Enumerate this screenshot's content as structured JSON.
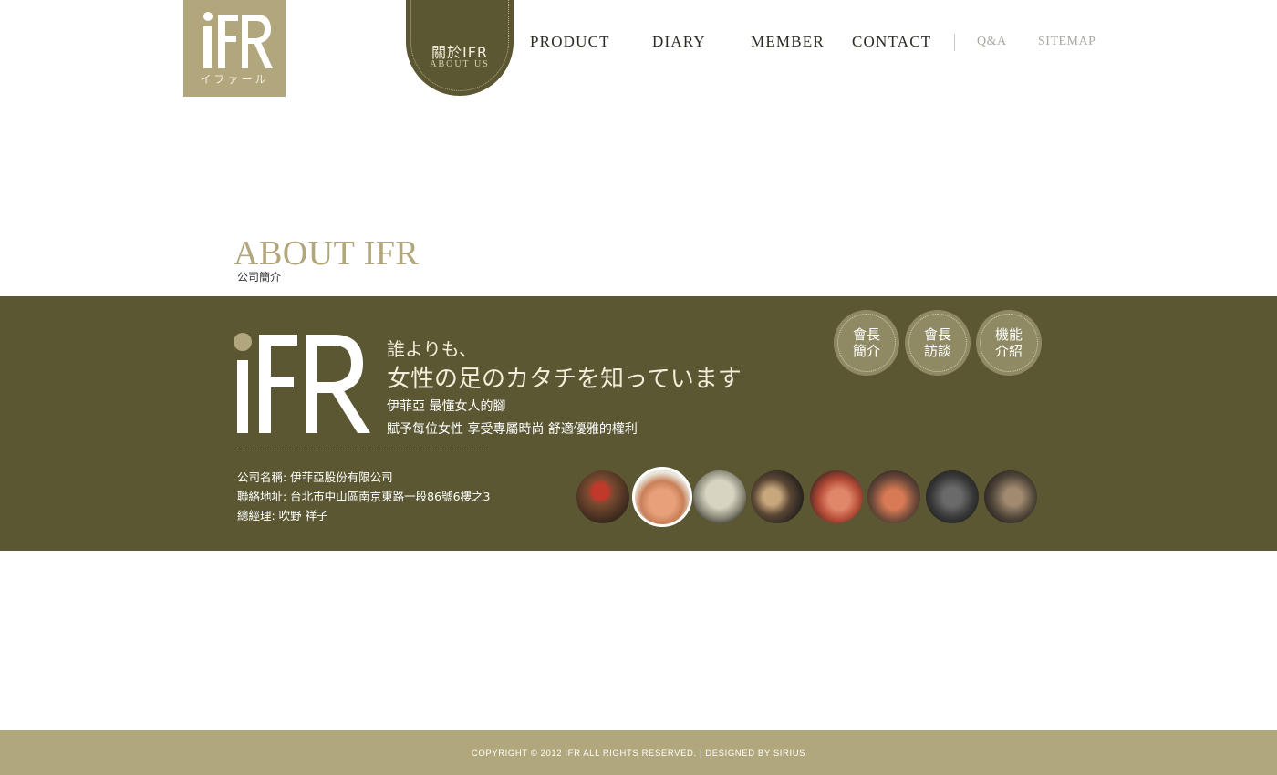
{
  "logo": {
    "sub": "イファール"
  },
  "nav": {
    "active": {
      "zh": "關於IFR",
      "en": "ABOUT US"
    },
    "items": [
      "PRODUCT",
      "DIARY",
      "MEMBER",
      "CONTACT"
    ],
    "secondary": [
      "Q&A",
      "SITEMAP"
    ]
  },
  "page": {
    "title": "ABOUT IFR",
    "subtitle": "公司簡介"
  },
  "intro": {
    "line1": "誰よりも、",
    "line2": "女性の足のカタチを知っています",
    "line3": "伊菲亞 最懂女人的腳",
    "line4": "賦予每位女性 享受專屬時尚 舒適優雅的權利"
  },
  "info": {
    "company": "公司名稱: 伊菲亞股份有限公司",
    "address": "聯絡地址: 台北市中山區南京東路一段86號6樓之3",
    "manager": "總經理: 吹野 祥子"
  },
  "circle_buttons": [
    {
      "l1": "會長",
      "l2": "簡介"
    },
    {
      "l1": "會長",
      "l2": "訪談"
    },
    {
      "l1": "機能",
      "l2": "介紹"
    }
  ],
  "gallery": {
    "active_index": 2,
    "count": 8
  },
  "colors": {
    "olive": "#5a5732",
    "khaki": "#b1a67c",
    "circle": "#8f8a64"
  },
  "footer": {
    "text": "COPYRIGHT © 2012 IFR  ALL RIGHTS RESERVED. | DESIGNED BY SIRIUS"
  }
}
